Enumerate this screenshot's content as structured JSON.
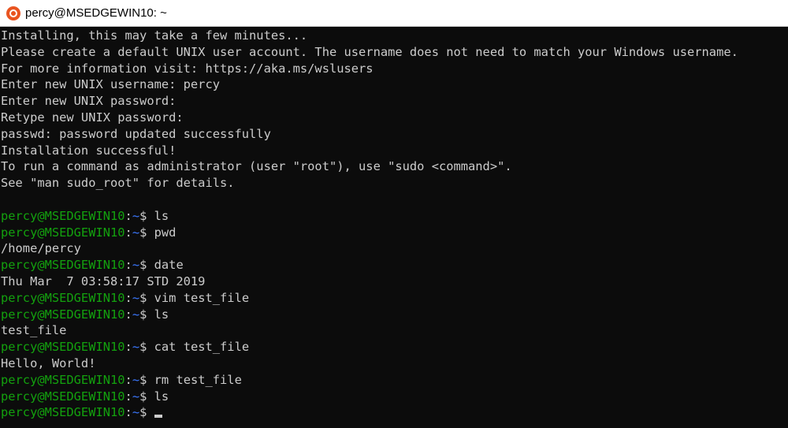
{
  "window": {
    "title": "percy@MSEDGEWIN10: ~",
    "icon": "ubuntu-icon"
  },
  "colors": {
    "background": "#0c0c0c",
    "text": "#cccccc",
    "prompt_user": "#13a10e",
    "prompt_path": "#3b78ff"
  },
  "output_block": [
    "Installing, this may take a few minutes...",
    "Please create a default UNIX user account. The username does not need to match your Windows username.",
    "For more information visit: https://aka.ms/wslusers",
    "Enter new UNIX username: percy",
    "Enter new UNIX password:",
    "Retype new UNIX password:",
    "passwd: password updated successfully",
    "Installation successful!",
    "To run a command as administrator (user \"root\"), use \"sudo <command>\".",
    "See \"man sudo_root\" for details.",
    ""
  ],
  "prompt": {
    "user": "percy@MSEDGEWIN10",
    "sep": ":",
    "path": "~",
    "symbol": "$ "
  },
  "session": [
    {
      "cmd": "ls"
    },
    {
      "cmd": "pwd",
      "out": "/home/percy"
    },
    {
      "cmd": "date",
      "out": "Thu Mar  7 03:58:17 STD 2019"
    },
    {
      "cmd": "vim test_file"
    },
    {
      "cmd": "ls",
      "out": "test_file"
    },
    {
      "cmd": "cat test_file",
      "out": "Hello, World!"
    },
    {
      "cmd": "rm test_file"
    },
    {
      "cmd": "ls"
    },
    {
      "cmd": ""
    }
  ]
}
